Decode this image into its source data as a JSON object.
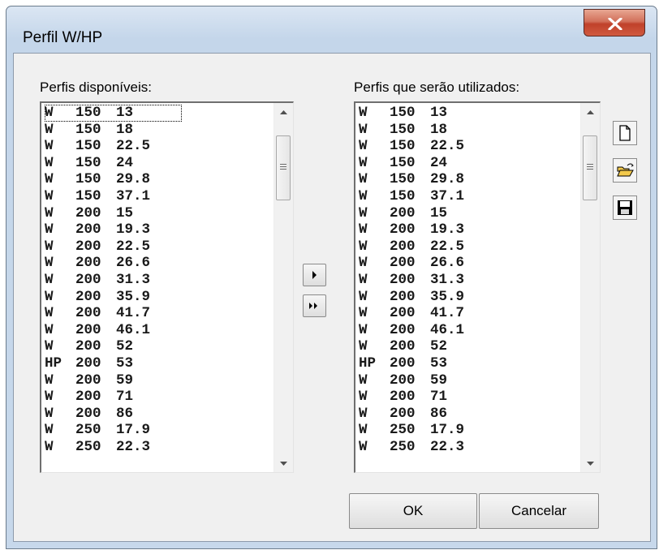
{
  "window": {
    "title": "Perfil W/HP"
  },
  "available": {
    "label": "Perfis disponíveis:",
    "items": [
      {
        "type": "W",
        "h": "150",
        "w": "13"
      },
      {
        "type": "W",
        "h": "150",
        "w": "18"
      },
      {
        "type": "W",
        "h": "150",
        "w": "22.5"
      },
      {
        "type": "W",
        "h": "150",
        "w": "24"
      },
      {
        "type": "W",
        "h": "150",
        "w": "29.8"
      },
      {
        "type": "W",
        "h": "150",
        "w": "37.1"
      },
      {
        "type": "W",
        "h": "200",
        "w": "15"
      },
      {
        "type": "W",
        "h": "200",
        "w": "19.3"
      },
      {
        "type": "W",
        "h": "200",
        "w": "22.5"
      },
      {
        "type": "W",
        "h": "200",
        "w": "26.6"
      },
      {
        "type": "W",
        "h": "200",
        "w": "31.3"
      },
      {
        "type": "W",
        "h": "200",
        "w": "35.9"
      },
      {
        "type": "W",
        "h": "200",
        "w": "41.7"
      },
      {
        "type": "W",
        "h": "200",
        "w": "46.1"
      },
      {
        "type": "W",
        "h": "200",
        "w": "52"
      },
      {
        "type": "HP",
        "h": "200",
        "w": "53"
      },
      {
        "type": "W",
        "h": "200",
        "w": "59"
      },
      {
        "type": "W",
        "h": "200",
        "w": "71"
      },
      {
        "type": "W",
        "h": "200",
        "w": "86"
      },
      {
        "type": "W",
        "h": "250",
        "w": "17.9"
      },
      {
        "type": "W",
        "h": "250",
        "w": "22.3"
      }
    ]
  },
  "selected": {
    "label": "Perfis que serão utilizados:",
    "items": [
      {
        "type": "W",
        "h": "150",
        "w": "13"
      },
      {
        "type": "W",
        "h": "150",
        "w": "18"
      },
      {
        "type": "W",
        "h": "150",
        "w": "22.5"
      },
      {
        "type": "W",
        "h": "150",
        "w": "24"
      },
      {
        "type": "W",
        "h": "150",
        "w": "29.8"
      },
      {
        "type": "W",
        "h": "150",
        "w": "37.1"
      },
      {
        "type": "W",
        "h": "200",
        "w": "15"
      },
      {
        "type": "W",
        "h": "200",
        "w": "19.3"
      },
      {
        "type": "W",
        "h": "200",
        "w": "22.5"
      },
      {
        "type": "W",
        "h": "200",
        "w": "26.6"
      },
      {
        "type": "W",
        "h": "200",
        "w": "31.3"
      },
      {
        "type": "W",
        "h": "200",
        "w": "35.9"
      },
      {
        "type": "W",
        "h": "200",
        "w": "41.7"
      },
      {
        "type": "W",
        "h": "200",
        "w": "46.1"
      },
      {
        "type": "W",
        "h": "200",
        "w": "52"
      },
      {
        "type": "HP",
        "h": "200",
        "w": "53"
      },
      {
        "type": "W",
        "h": "200",
        "w": "59"
      },
      {
        "type": "W",
        "h": "200",
        "w": "71"
      },
      {
        "type": "W",
        "h": "200",
        "w": "86"
      },
      {
        "type": "W",
        "h": "250",
        "w": "17.9"
      },
      {
        "type": "W",
        "h": "250",
        "w": "22.3"
      }
    ]
  },
  "transfer": {
    "move_one_icon": "triangle-right-icon",
    "move_all_icon": "double-triangle-right-icon"
  },
  "toolbar": {
    "new_icon": "new-file-icon",
    "open_icon": "open-folder-icon",
    "save_icon": "save-disk-icon"
  },
  "buttons": {
    "ok": "OK",
    "cancel": "Cancelar"
  },
  "colors": {
    "close_button": "#c7462f",
    "folder": "#f2c94c"
  }
}
